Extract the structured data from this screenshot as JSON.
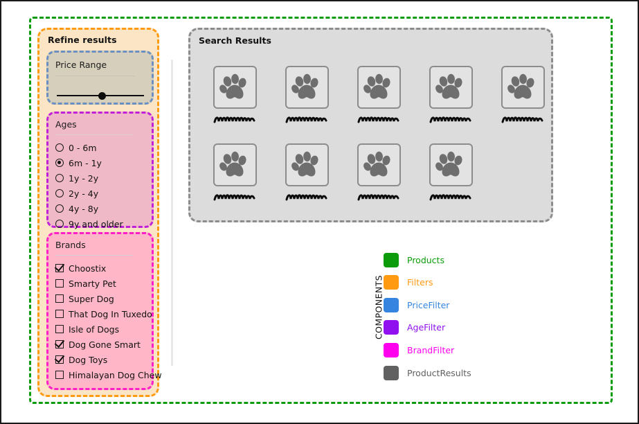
{
  "filters": {
    "title": "Refine results",
    "price": {
      "label": "Price Range",
      "slider_value_pct": 48
    },
    "ages": {
      "title": "Ages",
      "options": [
        {
          "label": "0 - 6m",
          "selected": false
        },
        {
          "label": "6m - 1y",
          "selected": true
        },
        {
          "label": "1y - 2y",
          "selected": false
        },
        {
          "label": "2y - 4y",
          "selected": false
        },
        {
          "label": "4y - 8y",
          "selected": false
        },
        {
          "label": "9y and older",
          "selected": false
        }
      ]
    },
    "brands": {
      "title": "Brands",
      "options": [
        {
          "label": "Choostix",
          "checked": true
        },
        {
          "label": "Smarty Pet",
          "checked": false
        },
        {
          "label": "Super Dog",
          "checked": false
        },
        {
          "label": "That Dog In Tuxedo",
          "checked": false
        },
        {
          "label": "Isle of Dogs",
          "checked": false
        },
        {
          "label": "Dog Gone Smart",
          "checked": true
        },
        {
          "label": "Dog Toys",
          "checked": true
        },
        {
          "label": "Himalayan Dog Chew",
          "checked": false
        }
      ]
    }
  },
  "results": {
    "title": "Search Results",
    "rows": [
      [
        {
          "icon": "paw-icon"
        },
        {
          "icon": "paw-icon"
        },
        {
          "icon": "paw-icon"
        },
        {
          "icon": "paw-icon"
        },
        {
          "icon": "paw-icon"
        }
      ],
      [
        {
          "icon": "paw-icon"
        },
        {
          "icon": "paw-icon"
        },
        {
          "icon": "paw-icon"
        },
        {
          "icon": "paw-icon"
        }
      ]
    ]
  },
  "legend": {
    "axis_label": "COMPONENTS",
    "items": [
      {
        "label": "Products",
        "color": "#0b9b0b"
      },
      {
        "label": "Filters",
        "color": "#ff9a11"
      },
      {
        "label": "PriceFilter",
        "color": "#3585e0"
      },
      {
        "label": "AgeFilter",
        "color": "#9010f0"
      },
      {
        "label": "BrandFilter",
        "color": "#ff00ee"
      },
      {
        "label": "ProductResults",
        "color": "#616161"
      }
    ]
  }
}
